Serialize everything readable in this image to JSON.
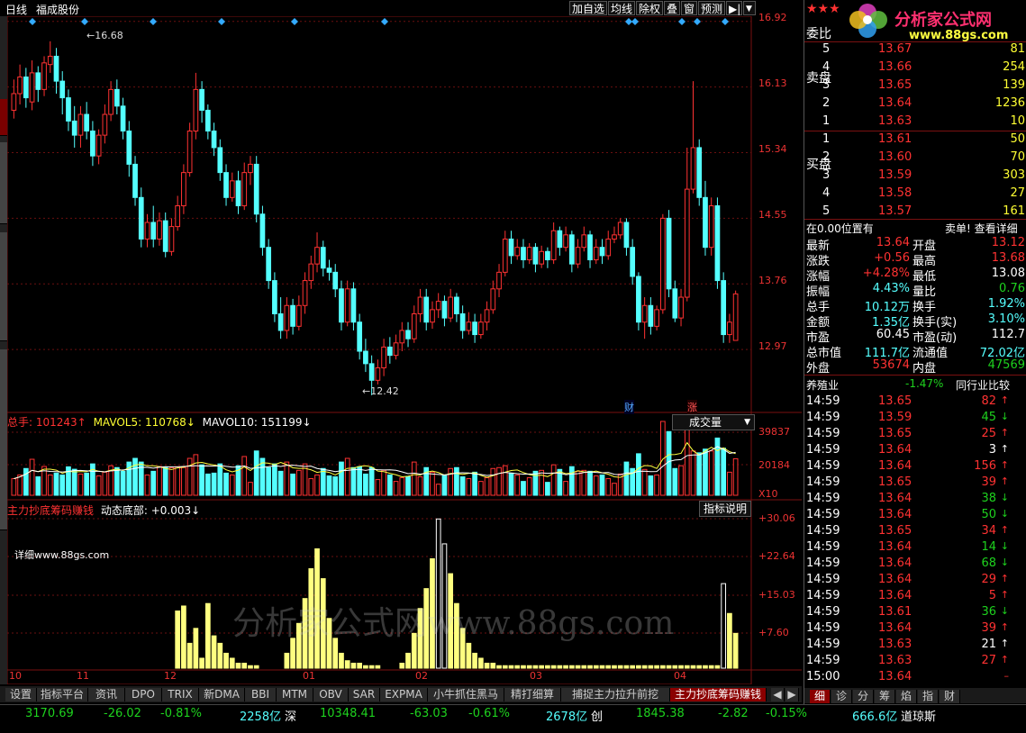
{
  "toolbar": {
    "period": "日线",
    "stock_name": "福成股份",
    "buttons": [
      "加自选",
      "均线",
      "除权",
      "叠",
      "窗",
      "预测"
    ],
    "nav_arrow": "▶|",
    "dropdown_arrow": "▼"
  },
  "main_chart": {
    "price_axis": [
      "16.92",
      "16.13",
      "15.34",
      "14.55",
      "13.76",
      "12.97"
    ],
    "high_mark": "16.68",
    "low_mark": "12.42",
    "event_labels": [
      "财",
      "涨"
    ]
  },
  "volume_pane": {
    "label_total": "总手: 101243↑",
    "label_ma5": "MAVOL5: 110768↓",
    "label_ma10": "MAVOL10: 151199↓",
    "dropdown": "成交量",
    "axis": [
      "39837",
      "20184",
      "X10"
    ]
  },
  "indicator_pane": {
    "name": "主力抄底筹码赚钱",
    "value_label": "动态底部: +0.003↓",
    "button": "指标说明",
    "detail_text": "详细www.88gs.com",
    "axis": [
      "+30.06",
      "+22.64",
      "+15.03",
      "+7.60"
    ]
  },
  "watermark": "分析家公式网www.88gs.com",
  "date_axis": [
    "10",
    "11",
    "12",
    "01",
    "02",
    "03",
    "04"
  ],
  "bottom_tabs": [
    "设置",
    "指标平台",
    "资讯",
    "DPO",
    "TRIX",
    "新DMA",
    "BBI",
    "MTM",
    "OBV",
    "SAR",
    "EXPMA",
    "小牛抓住黑马",
    "精打细算",
    "捕捉主力拉升前挖",
    "主力抄底筹码赚钱"
  ],
  "status_bar": {
    "sh_index": "3170.69",
    "sh_change": "-26.02",
    "sh_pct": "-0.81%",
    "sh_amount": "2258亿",
    "sh_name": "深",
    "sz_index": "10348.41",
    "sz_change": "-63.03",
    "sz_pct": "-0.61%",
    "sz_amount": "2678亿",
    "sz_name": "创",
    "cy_index": "1845.38",
    "cy_change": "-2.82",
    "cy_pct": "-0.15%",
    "cy_amount": "666.6亿",
    "cy_name": "道琼斯"
  },
  "right_panel": {
    "stars": "★★★",
    "logo_text": "分析家公式网",
    "logo_url": "www.88gs.com",
    "weibi_label": "委比",
    "sell_label": "卖盘",
    "buy_label": "买盘",
    "sell_orders": [
      {
        "level": "5",
        "price": "13.67",
        "vol": "81"
      },
      {
        "level": "4",
        "price": "13.66",
        "vol": "254"
      },
      {
        "level": "3",
        "price": "13.65",
        "vol": "139"
      },
      {
        "level": "2",
        "price": "13.64",
        "vol": "1236"
      },
      {
        "level": "1",
        "price": "13.63",
        "vol": "10"
      }
    ],
    "buy_orders": [
      {
        "level": "1",
        "price": "13.61",
        "vol": "50"
      },
      {
        "level": "2",
        "price": "13.60",
        "vol": "70"
      },
      {
        "level": "3",
        "price": "13.59",
        "vol": "303"
      },
      {
        "level": "4",
        "price": "13.58",
        "vol": "27"
      },
      {
        "level": "5",
        "price": "13.57",
        "vol": "161"
      }
    ],
    "position_info": "在0.00位置有",
    "position_link": "卖单! 查看详细",
    "quote": [
      {
        "l1": "最新",
        "v1": "13.64",
        "l2": "开盘",
        "v2": "13.12"
      },
      {
        "l1": "涨跌",
        "v1": "+0.56",
        "l2": "最高",
        "v2": "13.68"
      },
      {
        "l1": "涨幅",
        "v1": "+4.28%",
        "l2": "最低",
        "v2": "13.08"
      },
      {
        "l1": "振幅",
        "v1": "4.43%",
        "l2": "量比",
        "v2": "0.76"
      },
      {
        "l1": "总手",
        "v1": "10.12万",
        "l2": "换手",
        "v2": "1.92%"
      },
      {
        "l1": "金额",
        "v1": "1.35亿",
        "l2": "换手(实)",
        "v2": "3.10%"
      },
      {
        "l1": "市盈",
        "v1": "60.45",
        "l2": "市盈(动)",
        "v2": "112.7"
      },
      {
        "l1": "总市值",
        "v1": "111.7亿",
        "l2": "流通值",
        "v2": "72.02亿"
      },
      {
        "l1": "外盘",
        "v1": "53674",
        "l2": "内盘",
        "v2": "47569"
      }
    ],
    "industry": "养殖业",
    "industry_pct": "-1.47%",
    "industry_compare": "同行业比较",
    "ticks": [
      {
        "t": "14:59",
        "p": "13.65",
        "v": "82",
        "d": "up"
      },
      {
        "t": "14:59",
        "p": "13.59",
        "v": "45",
        "d": "down"
      },
      {
        "t": "14:59",
        "p": "13.65",
        "v": "25",
        "d": "up"
      },
      {
        "t": "14:59",
        "p": "13.64",
        "v": "3",
        "d": "neutral"
      },
      {
        "t": "14:59",
        "p": "13.64",
        "v": "156",
        "d": "up"
      },
      {
        "t": "14:59",
        "p": "13.65",
        "v": "39",
        "d": "up"
      },
      {
        "t": "14:59",
        "p": "13.64",
        "v": "38",
        "d": "down"
      },
      {
        "t": "14:59",
        "p": "13.64",
        "v": "50",
        "d": "down"
      },
      {
        "t": "14:59",
        "p": "13.65",
        "v": "34",
        "d": "up"
      },
      {
        "t": "14:59",
        "p": "13.64",
        "v": "14",
        "d": "down"
      },
      {
        "t": "14:59",
        "p": "13.64",
        "v": "68",
        "d": "down"
      },
      {
        "t": "14:59",
        "p": "13.64",
        "v": "29",
        "d": "up"
      },
      {
        "t": "14:59",
        "p": "13.64",
        "v": "5",
        "d": "up"
      },
      {
        "t": "14:59",
        "p": "13.61",
        "v": "36",
        "d": "down"
      },
      {
        "t": "14:59",
        "p": "13.64",
        "v": "39",
        "d": "up"
      },
      {
        "t": "14:59",
        "p": "13.63",
        "v": "21",
        "d": "neutral"
      },
      {
        "t": "14:59",
        "p": "13.63",
        "v": "27",
        "d": "up"
      },
      {
        "t": "15:00",
        "p": "13.64",
        "v": "",
        "d": "none"
      }
    ],
    "bottom_tabs": [
      "细",
      "诊",
      "分",
      "筹",
      "焰",
      "指",
      "财"
    ]
  },
  "chart_data": {
    "type": "candlestick",
    "candles": [
      [
        15.85,
        16.05,
        16.22,
        15.75
      ],
      [
        16.05,
        16.25,
        16.4,
        15.92
      ],
      [
        16.25,
        16.0,
        16.36,
        15.88
      ],
      [
        15.95,
        16.3,
        16.45,
        15.85
      ],
      [
        16.3,
        16.1,
        16.38,
        15.95
      ],
      [
        16.1,
        16.42,
        16.5,
        16.02
      ],
      [
        16.4,
        16.5,
        16.68,
        16.3
      ],
      [
        16.5,
        16.2,
        16.6,
        16.05
      ],
      [
        16.2,
        16.0,
        16.32,
        15.8
      ],
      [
        16.0,
        15.72,
        16.1,
        15.6
      ],
      [
        15.72,
        15.55,
        15.9,
        15.4
      ],
      [
        15.55,
        15.8,
        15.9,
        15.4
      ],
      [
        15.8,
        15.6,
        15.95,
        15.5
      ],
      [
        15.6,
        15.3,
        15.72,
        15.18
      ],
      [
        15.3,
        15.55,
        15.62,
        15.2
      ],
      [
        15.55,
        15.8,
        15.92,
        15.45
      ],
      [
        15.8,
        16.1,
        16.2,
        15.72
      ],
      [
        16.1,
        15.9,
        16.22,
        15.8
      ],
      [
        15.9,
        15.6,
        16.0,
        15.5
      ],
      [
        15.6,
        15.2,
        15.72,
        15.05
      ],
      [
        15.2,
        14.8,
        15.3,
        14.7
      ],
      [
        14.8,
        14.3,
        14.92,
        14.2
      ],
      [
        14.3,
        14.5,
        14.6,
        14.2
      ],
      [
        14.5,
        14.3,
        14.7,
        14.2
      ],
      [
        14.3,
        14.52,
        14.62,
        14.22
      ],
      [
        14.52,
        14.15,
        14.62,
        14.08
      ],
      [
        14.15,
        14.45,
        14.55,
        14.1
      ],
      [
        14.45,
        14.7,
        14.82,
        14.4
      ],
      [
        14.7,
        15.1,
        15.2,
        14.6
      ],
      [
        15.1,
        15.6,
        15.7,
        15.05
      ],
      [
        15.6,
        16.1,
        16.3,
        15.5
      ],
      [
        16.1,
        15.85,
        16.2,
        15.7
      ],
      [
        15.85,
        15.6,
        15.92,
        15.5
      ],
      [
        15.6,
        15.4,
        15.7,
        15.3
      ],
      [
        15.4,
        15.1,
        15.5,
        15.0
      ],
      [
        15.1,
        14.8,
        15.2,
        14.7
      ],
      [
        14.8,
        15.0,
        15.1,
        14.75
      ],
      [
        15.0,
        14.7,
        15.12,
        14.6
      ],
      [
        14.7,
        15.1,
        15.22,
        14.65
      ],
      [
        15.1,
        15.2,
        15.3,
        14.95
      ],
      [
        15.2,
        14.6,
        15.3,
        14.5
      ],
      [
        14.6,
        14.2,
        14.7,
        14.1
      ],
      [
        14.2,
        13.8,
        14.3,
        13.7
      ],
      [
        13.8,
        13.4,
        13.9,
        13.3
      ],
      [
        13.4,
        13.2,
        13.6,
        13.1
      ],
      [
        13.2,
        13.5,
        13.6,
        13.1
      ],
      [
        13.5,
        13.25,
        13.58,
        13.15
      ],
      [
        13.25,
        13.5,
        13.62,
        13.2
      ],
      [
        13.5,
        13.8,
        13.9,
        13.4
      ],
      [
        13.8,
        14.0,
        14.1,
        13.7
      ],
      [
        14.0,
        14.2,
        14.38,
        13.9
      ],
      [
        14.2,
        13.95,
        14.28,
        13.85
      ],
      [
        13.95,
        13.9,
        14.05,
        13.8
      ],
      [
        13.9,
        13.7,
        14.0,
        13.6
      ],
      [
        13.7,
        13.3,
        13.8,
        13.2
      ],
      [
        13.3,
        13.7,
        13.8,
        13.25
      ],
      [
        13.7,
        13.3,
        13.78,
        13.2
      ],
      [
        13.3,
        12.95,
        13.4,
        12.85
      ],
      [
        12.95,
        12.8,
        13.1,
        12.7
      ],
      [
        12.8,
        12.6,
        12.9,
        12.42
      ],
      [
        12.6,
        12.75,
        12.85,
        12.55
      ],
      [
        12.75,
        13.0,
        13.1,
        12.65
      ],
      [
        13.0,
        12.9,
        13.12,
        12.8
      ],
      [
        12.9,
        13.05,
        13.15,
        12.85
      ],
      [
        13.05,
        13.2,
        13.3,
        12.95
      ],
      [
        13.2,
        13.1,
        13.3,
        13.0
      ],
      [
        13.1,
        13.4,
        13.5,
        13.05
      ],
      [
        13.4,
        13.6,
        13.7,
        13.3
      ],
      [
        13.6,
        13.3,
        13.7,
        13.2
      ],
      [
        13.3,
        13.45,
        13.55,
        13.22
      ],
      [
        13.45,
        13.55,
        13.65,
        13.35
      ],
      [
        13.55,
        13.35,
        13.62,
        13.25
      ],
      [
        13.35,
        13.6,
        13.7,
        13.3
      ],
      [
        13.6,
        13.4,
        13.65,
        13.3
      ],
      [
        13.4,
        13.2,
        13.5,
        13.1
      ],
      [
        13.2,
        13.3,
        13.42,
        13.15
      ],
      [
        13.3,
        13.15,
        13.4,
        13.05
      ],
      [
        13.15,
        13.3,
        13.4,
        13.1
      ],
      [
        13.3,
        13.45,
        13.55,
        13.2
      ],
      [
        13.45,
        13.7,
        13.8,
        13.4
      ],
      [
        13.7,
        13.9,
        14.0,
        13.6
      ],
      [
        13.9,
        14.3,
        14.4,
        13.85
      ],
      [
        14.3,
        14.1,
        14.4,
        14.0
      ],
      [
        14.1,
        14.2,
        14.3,
        14.05
      ],
      [
        14.2,
        14.05,
        14.3,
        13.95
      ],
      [
        14.05,
        14.2,
        14.25,
        14.0
      ],
      [
        14.2,
        14.0,
        14.25,
        13.9
      ],
      [
        14.0,
        14.15,
        14.22,
        13.95
      ],
      [
        14.15,
        14.05,
        14.2,
        13.95
      ],
      [
        14.05,
        14.4,
        14.5,
        14.0
      ],
      [
        14.4,
        14.2,
        14.45,
        14.1
      ],
      [
        14.2,
        14.35,
        14.45,
        14.15
      ],
      [
        14.35,
        14.0,
        14.4,
        13.9
      ],
      [
        14.0,
        14.2,
        14.3,
        13.95
      ],
      [
        14.2,
        14.35,
        14.45,
        14.15
      ],
      [
        14.35,
        14.05,
        14.4,
        13.95
      ],
      [
        14.05,
        14.2,
        14.3,
        14.0
      ],
      [
        14.2,
        14.1,
        14.3,
        14.0
      ],
      [
        14.1,
        14.3,
        14.4,
        14.05
      ],
      [
        14.3,
        14.35,
        14.45,
        14.25
      ],
      [
        14.35,
        14.5,
        14.55,
        14.3
      ],
      [
        14.5,
        14.2,
        14.55,
        14.1
      ],
      [
        14.2,
        13.85,
        14.3,
        13.75
      ],
      [
        13.85,
        13.3,
        13.9,
        13.2
      ],
      [
        13.3,
        13.5,
        13.6,
        13.1
      ],
      [
        13.5,
        13.25,
        13.6,
        13.15
      ],
      [
        13.25,
        13.45,
        13.5,
        13.2
      ],
      [
        13.45,
        14.55,
        14.6,
        13.4
      ],
      [
        14.55,
        13.7,
        14.65,
        13.6
      ],
      [
        13.7,
        13.35,
        13.8,
        13.3
      ],
      [
        13.35,
        13.6,
        13.7,
        13.25
      ],
      [
        13.6,
        14.9,
        15.4,
        13.55
      ],
      [
        14.9,
        15.4,
        16.2,
        14.85
      ],
      [
        15.4,
        14.8,
        15.5,
        14.7
      ],
      [
        14.8,
        14.2,
        15.0,
        14.1
      ],
      [
        14.2,
        14.7,
        14.8,
        14.1
      ],
      [
        14.7,
        13.8,
        14.8,
        13.7
      ],
      [
        13.8,
        13.15,
        13.9,
        13.05
      ],
      [
        13.15,
        13.3,
        13.4,
        13.05
      ],
      [
        13.08,
        13.64,
        13.68,
        13.08
      ]
    ]
  }
}
